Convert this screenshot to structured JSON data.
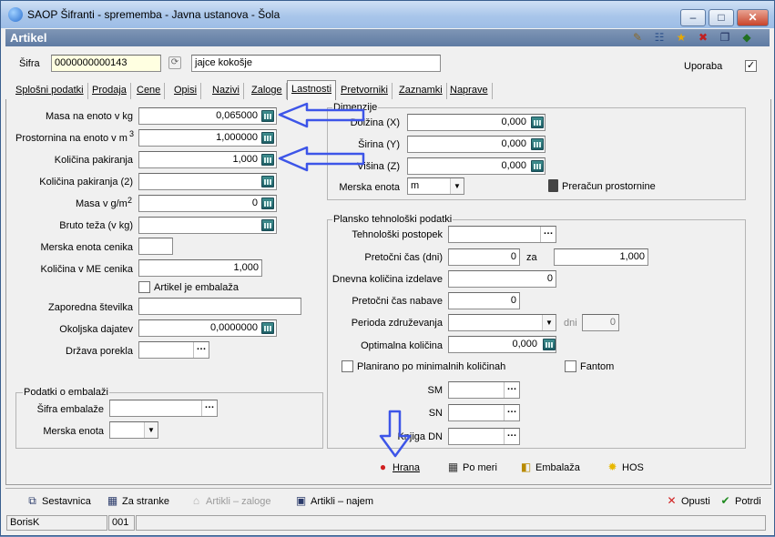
{
  "window": {
    "title": "SAOP Šifranti - sprememba - Javna ustanova - Šola",
    "form_title": "Artikel",
    "controls": {
      "minimize": "–",
      "maximize": "□",
      "close": "✕"
    }
  },
  "header": {
    "sifra_label": "Šifra",
    "sifra_value": "0000000000143",
    "name_value": "jajce kokošje",
    "uporaba_label": "Uporaba",
    "uporaba_checked": "✓"
  },
  "tabs": [
    {
      "label": "Splošni podatki"
    },
    {
      "label": "Prodaja"
    },
    {
      "label": "Cene"
    },
    {
      "label": "Opisi"
    },
    {
      "label": "Nazivi"
    },
    {
      "label": "Zaloge"
    },
    {
      "label": "Lastnosti"
    },
    {
      "label": "Pretvorniki"
    },
    {
      "label": "Zaznamki"
    },
    {
      "label": "Naprave"
    }
  ],
  "left": {
    "masa_label": "Masa na enoto v kg",
    "masa_value": "0,065000",
    "prostornina_label": "Prostornina na enoto v m",
    "prostornina_sup": "3",
    "prostornina_value": "1,000000",
    "kolicina_pak_label": "Količina pakiranja",
    "kolicina_pak_value": "1,000",
    "kolicina_pak2_label": "Količina pakiranja (2)",
    "kolicina_pak2_value": "",
    "masa_gm2_label": "Masa v g/m",
    "masa_gm2_sup": "2",
    "masa_gm2_value": "0",
    "bruto_label": "Bruto teža (v kg)",
    "bruto_value": "",
    "merska_cenik_label": "Merska enota cenika",
    "merska_cenik_value": "",
    "kolicina_me_label": "Količina v ME cenika",
    "kolicina_me_value": "1,000",
    "embalaza_chk_label": "Artikel je embalaža",
    "zaporedna_label": "Zaporedna številka",
    "zaporedna_value": "",
    "okoljska_label": "Okoljska dajatev",
    "okoljska_value": "0,0000000",
    "drzava_label": "Država porekla",
    "drzava_value": ""
  },
  "embalaza_group": {
    "title": "Podatki o embalaži",
    "sifra_label": "Šifra embalaže",
    "sifra_value": "",
    "merska_label": "Merska enota",
    "merska_value": ""
  },
  "dimenzije": {
    "title": "Dimenzije",
    "dolzina_label": "Dolžina (X)",
    "dolzina_value": "0,000",
    "sirina_label": "Širina (Y)",
    "sirina_value": "0,000",
    "visina_label": "Višina (Z)",
    "visina_value": "0,000",
    "merska_label": "Merska enota",
    "merska_value": "m",
    "preracun_label": "Preračun prostornine"
  },
  "plansko": {
    "title": "Plansko tehnološki podatki",
    "postopek_label": "Tehnološki postopek",
    "postopek_value": "",
    "pretocni_label": "Pretočni čas (dni)",
    "pretocni_value": "0",
    "za_label": "za",
    "za_value": "1,000",
    "dnevna_label": "Dnevna količina izdelave",
    "dnevna_value": "0",
    "nabava_label": "Pretočni čas nabave",
    "nabava_value": "0",
    "perioda_label": "Perioda združevanja",
    "perioda_value": "",
    "dni_label": "dni",
    "dni_value": "0",
    "optimalna_label": "Optimalna količina",
    "optimalna_value": "0,000",
    "planirano_label": "Planirano po minimalnih količinah",
    "fantom_label": "Fantom",
    "sm_label": "SM",
    "sm_value": "",
    "sn_label": "SN",
    "sn_value": "",
    "knjiga_label": "Knjiga DN",
    "knjiga_value": ""
  },
  "mid_buttons": {
    "hrana": "Hrana",
    "pomeri": "Po meri",
    "embalaza": "Embalaža",
    "hos": "HOS"
  },
  "bottom_buttons": {
    "sestavnica": "Sestavnica",
    "zastranke": "Za stranke",
    "artikli_zaloge": "Artikli – zaloge",
    "artikli_najem": "Artikli – najem",
    "opusti": "Opusti",
    "potrdi": "Potrdi"
  },
  "statusbar": {
    "user": "BorisK",
    "code": "001"
  },
  "colors": {
    "annotation_arrow": "#3d55e8",
    "title_accent": "#5f7ba3"
  }
}
